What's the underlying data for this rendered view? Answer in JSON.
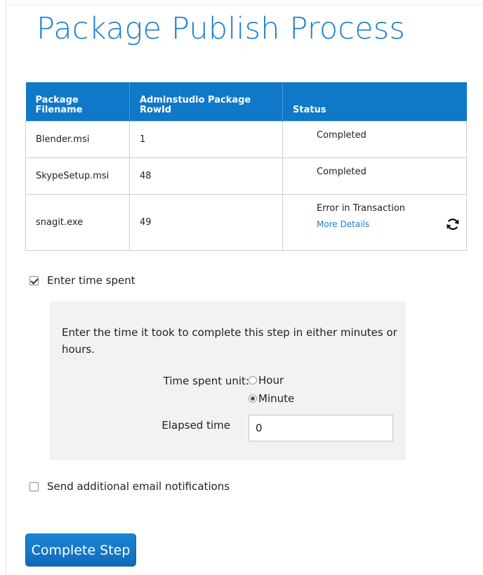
{
  "page": {
    "title": "Package Publish Process"
  },
  "table": {
    "headers": [
      "Package Filename",
      "Adminstudio Package RowId",
      "Status"
    ],
    "rows": [
      {
        "filename": "Blender.msi",
        "rowid": "1",
        "status": "Completed"
      },
      {
        "filename": "SkypeSetup.msi",
        "rowid": "48",
        "status": "Completed"
      },
      {
        "filename": "snagit.exe",
        "rowid": "49",
        "status": "Error in Transaction",
        "details_link": "More Details",
        "action_icon": "refresh-icon"
      }
    ]
  },
  "time_spent": {
    "checkbox_label": "Enter time spent",
    "checked": true,
    "description": "Enter the time it took to complete this step in either minutes or hours.",
    "unit_label": "Time spent unit:",
    "unit_options": [
      "Hour",
      "Minute"
    ],
    "selected_unit": "Minute",
    "elapsed_label": "Elapsed time",
    "elapsed_value": "0"
  },
  "notifications": {
    "checkbox_label": "Send additional email notifications",
    "checked": false
  },
  "actions": {
    "complete_label": "Complete Step"
  },
  "colors": {
    "accent": "#0f78c8",
    "title": "#1a7fd0",
    "panel_bg": "#f2f2f2"
  }
}
